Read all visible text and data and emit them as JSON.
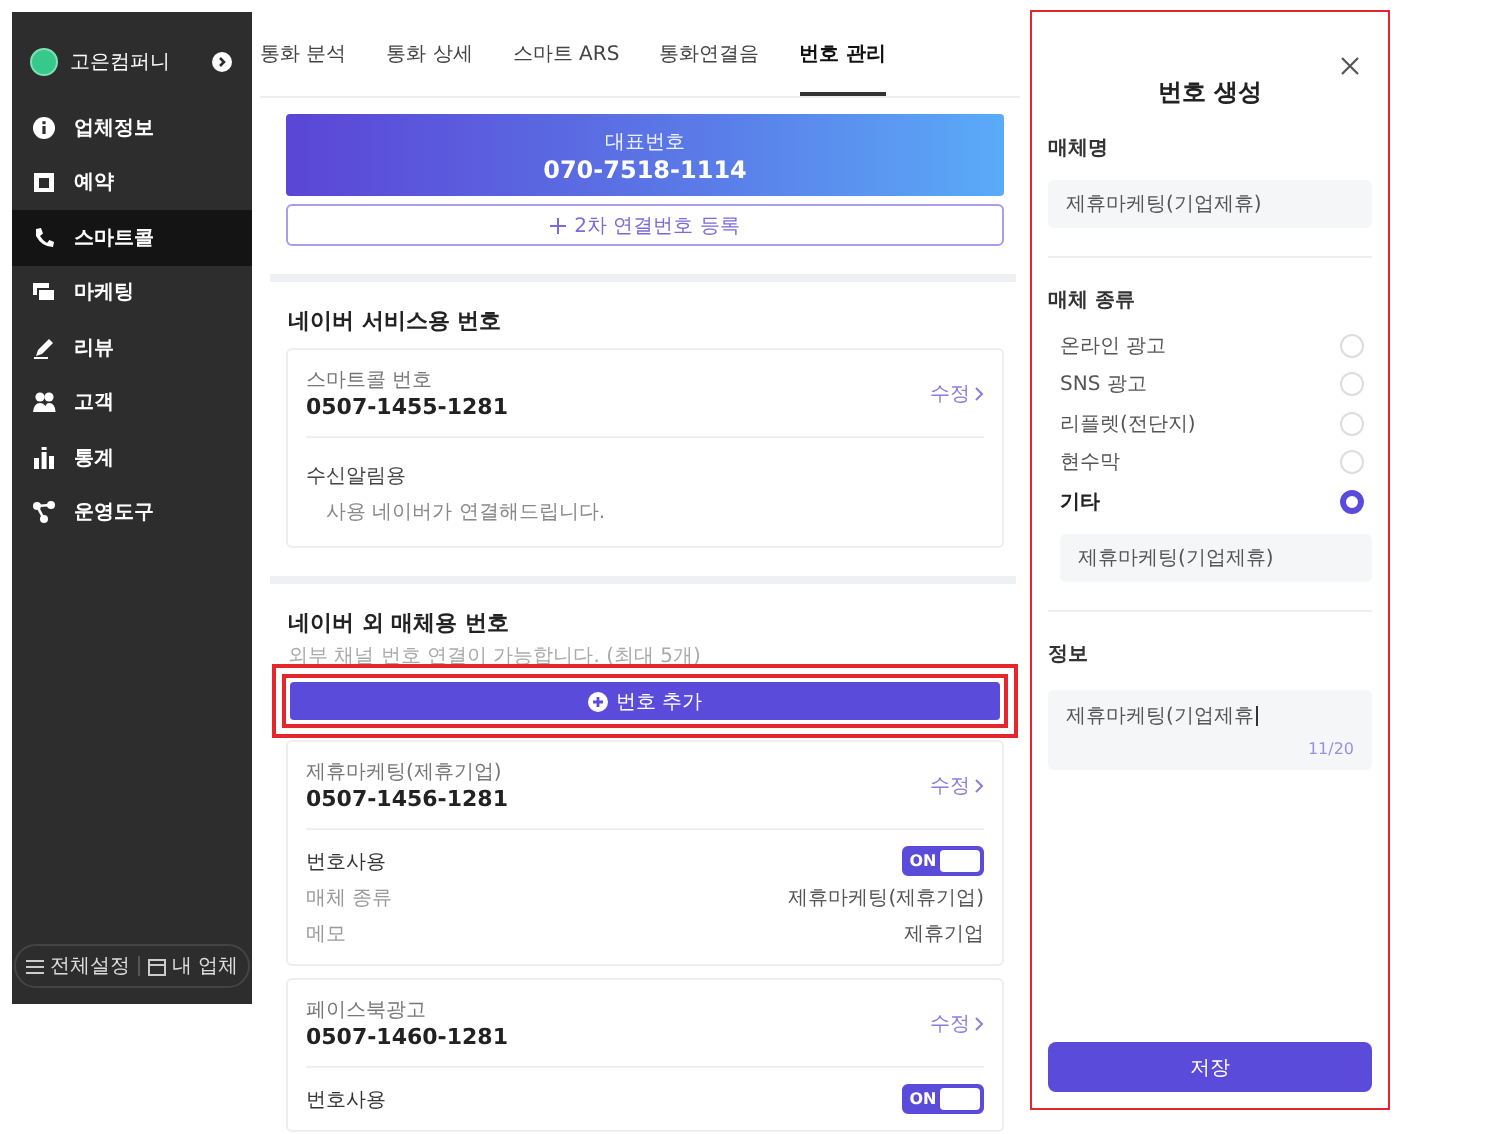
{
  "sidebar": {
    "company": "고은컴퍼니",
    "items": [
      {
        "label": "업체정보",
        "selected": false
      },
      {
        "label": "예약",
        "selected": false
      },
      {
        "label": "스마트콜",
        "selected": true
      },
      {
        "label": "마케팅",
        "selected": false
      },
      {
        "label": "리뷰",
        "selected": false
      },
      {
        "label": "고객",
        "selected": false
      },
      {
        "label": "통계",
        "selected": false
      },
      {
        "label": "운영도구",
        "selected": false
      }
    ],
    "footer_buttons": [
      "전체설정",
      "내 업체"
    ]
  },
  "tabs": [
    {
      "label": "통화 분석",
      "selected": false
    },
    {
      "label": "통화 상세",
      "selected": false
    },
    {
      "label": "스마트 ARS",
      "selected": false
    },
    {
      "label": "통화연결음",
      "selected": false
    },
    {
      "label": "번호 관리",
      "selected": true
    }
  ],
  "representative": {
    "label": "대표번호",
    "number": "070-7518-1114"
  },
  "secondary_button": "2차 연결번호 등록",
  "naver_section": {
    "title": "네이버 서비스용 번호",
    "card": {
      "label": "스마트콜 번호",
      "number": "0507-1455-1281",
      "edit": "수정",
      "sub_label": "수신알림용",
      "note": "사용 네이버가 연결해드립니다."
    }
  },
  "media_section": {
    "title": "네이버 외 매체용 번호",
    "subtitle": "외부 채널 번호 연결이 가능합니다. (최대 5개)",
    "add_button": {
      "label": "번호 추가",
      "highlighted": true
    },
    "cards": [
      {
        "label": "제휴마케팅(제휴기업)",
        "number": "0507-1456-1281",
        "edit": "수정",
        "toggle_label": "번호사용",
        "toggle_on": true,
        "toggle_text": "ON",
        "rows": [
          {
            "key": "매체 종류",
            "value": "제휴마케팅(제휴기업)"
          },
          {
            "key": "메모",
            "value": "제휴기업"
          }
        ]
      },
      {
        "label": "페이스북광고",
        "number": "0507-1460-1281",
        "edit": "수정",
        "toggle_label": "번호사용",
        "toggle_on": true,
        "toggle_text": "ON"
      }
    ]
  },
  "panel": {
    "highlighted": true,
    "title": "번호 생성",
    "media_name_label": "매체명",
    "media_name_value": "제휴마케팅(기업제휴)",
    "media_type_label": "매체 종류",
    "options": [
      {
        "label": "온라인 광고",
        "selected": false
      },
      {
        "label": "SNS 광고",
        "selected": false
      },
      {
        "label": "리플렛(전단지)",
        "selected": false
      },
      {
        "label": "현수막",
        "selected": false
      },
      {
        "label": "기타",
        "selected": true
      }
    ],
    "other_value": "제휴마케팅(기업제휴)",
    "info_label": "정보",
    "info_value": "제휴마케팅(기업제휴",
    "info_counter": "11/20",
    "save_button": "저장"
  }
}
